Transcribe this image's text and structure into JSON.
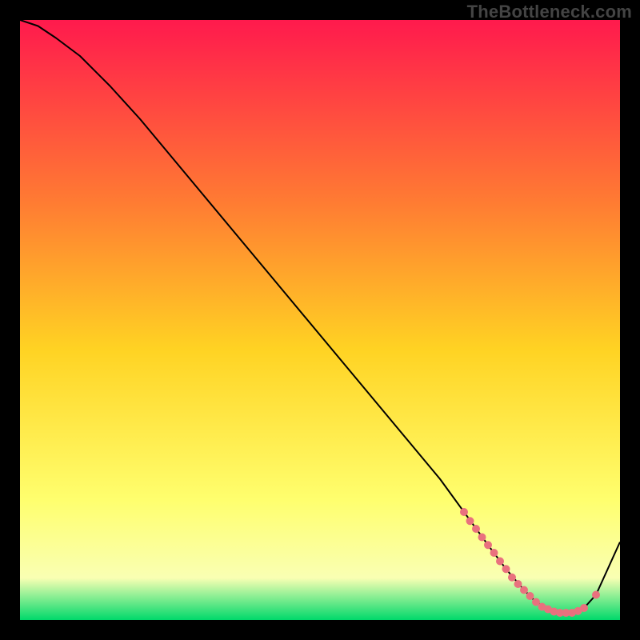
{
  "watermark": "TheBottleneck.com",
  "chart_data": {
    "type": "line",
    "title": "",
    "xlabel": "",
    "ylabel": "",
    "xlim": [
      0,
      100
    ],
    "ylim": [
      0,
      100
    ],
    "grid": false,
    "legend": false,
    "background_gradient": {
      "top": "#ff1a4d",
      "upper_mid": "#ff7a33",
      "mid": "#ffd323",
      "lower_mid": "#ffff6e",
      "near_bottom": "#f9ffb3",
      "bottom": "#00d96b"
    },
    "series": [
      {
        "name": "curve",
        "color": "#000000",
        "x": [
          0,
          3,
          6,
          10,
          15,
          20,
          25,
          30,
          35,
          40,
          45,
          50,
          55,
          60,
          65,
          70,
          74,
          78,
          81,
          84,
          86,
          88,
          90,
          92,
          94,
          96,
          100
        ],
        "y": [
          100,
          99,
          97,
          94,
          89,
          83.5,
          77.5,
          71.5,
          65.5,
          59.5,
          53.5,
          47.5,
          41.5,
          35.5,
          29.5,
          23.5,
          18,
          12.5,
          8.5,
          5,
          3,
          1.8,
          1.2,
          1.2,
          2,
          4.2,
          13
        ]
      }
    ],
    "dotted_points": {
      "name": "highlighted-range",
      "color": "#e9717e",
      "radius": 5,
      "x": [
        74,
        75,
        76,
        77,
        78,
        79,
        80,
        81,
        82,
        83,
        84,
        85,
        86,
        87,
        88,
        89,
        90,
        91,
        92,
        93,
        94,
        96
      ],
      "y": [
        18,
        16.5,
        15.2,
        13.8,
        12.5,
        11.2,
        9.8,
        8.5,
        7.1,
        6,
        5,
        4,
        3,
        2.2,
        1.8,
        1.4,
        1.2,
        1.2,
        1.2,
        1.5,
        2,
        4.2
      ]
    }
  }
}
